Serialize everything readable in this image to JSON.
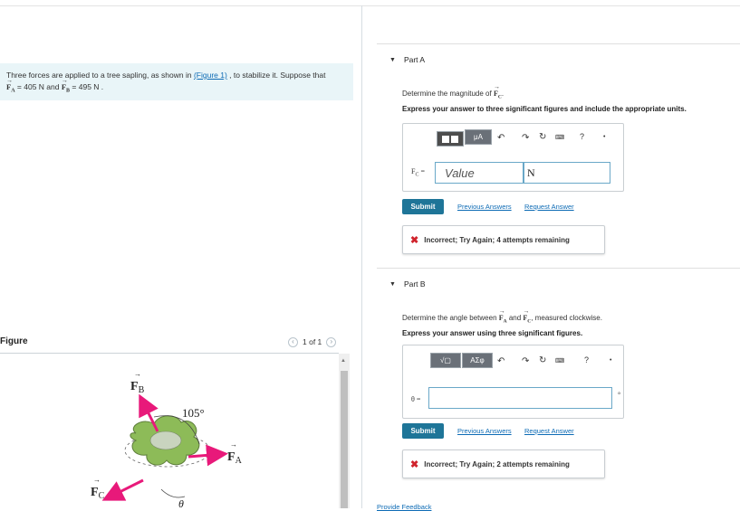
{
  "problem": {
    "line1_pre": "Three forces are applied to a tree sapling, as shown in ",
    "figure_link": "(Figure 1)",
    "line1_post": " , to stabilize it. Suppose that",
    "fa_sub": "A",
    "fa_value": " = 405  N and ",
    "fb_sub": "B",
    "fb_value": " = 495  N ."
  },
  "figure": {
    "label": "Figure",
    "pager_text": "1 of 1",
    "prev_icon": "chevron-left",
    "next_icon": "chevron-right",
    "labels": {
      "fb": "F",
      "fb_sub": "B",
      "fa": "F",
      "fa_sub": "A",
      "fc": "F",
      "fc_sub": "C",
      "angle": "105°",
      "theta": "θ"
    },
    "colors": {
      "arrow": "#e8197a",
      "foliage": "#8dbb58"
    }
  },
  "partA": {
    "title": "Part A",
    "question_pre": "Determine the magnitude of ",
    "question_sub": "C",
    "question_post": ".",
    "instruction": "Express your answer to three significant figures and include the appropriate units.",
    "field_label": "F",
    "field_sub": "C",
    "field_eq": " =",
    "value_placeholder": "Value",
    "unit_value": "N",
    "toolbar_units": "μA",
    "toolbar_help": "?",
    "submit": "Submit",
    "previous_answers": "Previous Answers",
    "request_answer": "Request Answer",
    "feedback": "Incorrect; Try Again; 4 attempts remaining"
  },
  "partB": {
    "title": "Part B",
    "question_pre": "Determine the angle between ",
    "question_sub1": "A",
    "question_mid": " and ",
    "question_sub2": "C",
    "question_post": ", measured clockwise.",
    "instruction": "Express your answer using three significant figures.",
    "field_label": "θ =",
    "unit_suffix": "°",
    "toolbar_sqrt": "√▢",
    "toolbar_greek": "ΑΣφ",
    "toolbar_help": "?",
    "submit": "Submit",
    "previous_answers": "Previous Answers",
    "request_answer": "Request Answer",
    "feedback": "Incorrect; Try Again; 2 attempts remaining"
  },
  "footer": {
    "provide_feedback": "Provide Feedback"
  }
}
